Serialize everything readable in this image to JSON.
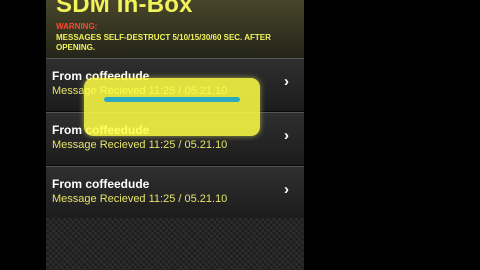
{
  "app": {
    "title": "SDM In-Box",
    "warning_label": "WARNING:",
    "warning_text": "MESSAGES SELF-DESTRUCT 5/10/15/30/60 SEC. AFTER OPENING."
  },
  "messages": [
    {
      "from": "From coffeedude",
      "received": "Message Recieved 11:25 / 05.21.10"
    },
    {
      "from": "From coffeedude",
      "received": "Message Recieved 11:25 / 05.21.10"
    },
    {
      "from": "From coffeedude",
      "received": "Message Recieved 11:25 / 05.21.10"
    }
  ],
  "icons": {
    "chevron": "chevron-right-icon"
  },
  "modal": {
    "progress_percent": 100
  },
  "colors": {
    "title": "#f3f35a",
    "warning": "#ff4a2e",
    "modal": "#ffff46",
    "progress": "#2aa9bf"
  }
}
